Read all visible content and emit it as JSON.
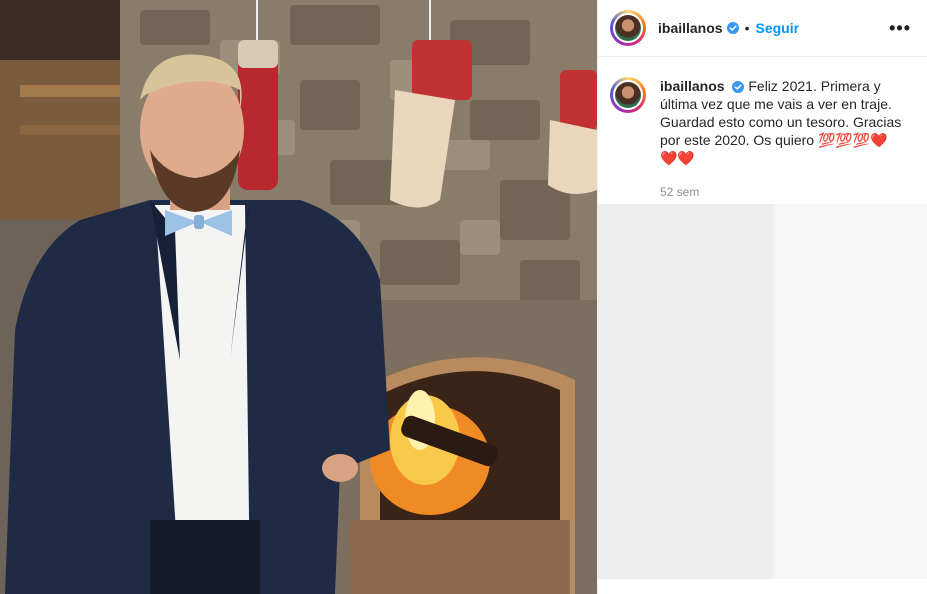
{
  "post": {
    "username": "ibaillanos",
    "follow_label": "Seguir",
    "separator": "•",
    "more_label": "•••",
    "caption": {
      "username": "ibaillanos",
      "text": "Feliz 2021. Primera y última vez que me vais a ver en traje. Guardad esto como un tesoro. Gracias por este 2020. Os quiero 💯💯💯❤️❤️❤️"
    },
    "timestamp": "52 sem",
    "photo_alt": "Person in navy suit and blue bow tie standing in front of a stone fireplace with Christmas stockings"
  },
  "colors": {
    "accent": "#0095f6",
    "verified": "#3897f0",
    "text": "#262626",
    "muted": "#8e8e8e"
  },
  "icons": [
    "verified-icon",
    "more-options-icon",
    "avatar"
  ]
}
